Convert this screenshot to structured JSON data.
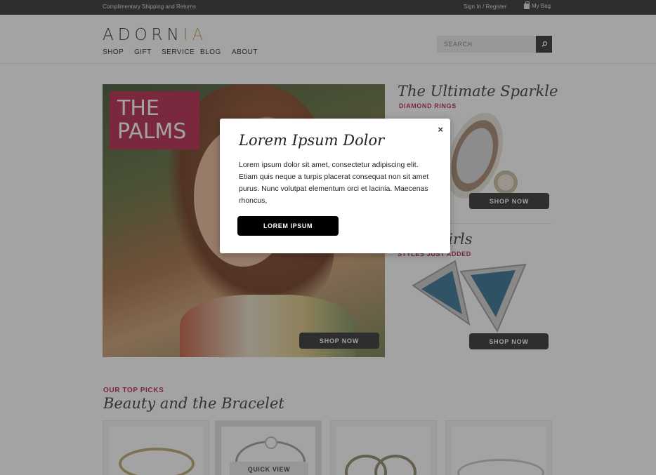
{
  "topbar": {
    "shipping_text": "Complimentary Shipping and Returns",
    "sign_in": "Sign In",
    "register": "Register",
    "bag_label": "My Bag",
    "bag_icon": "shopping-bag-icon"
  },
  "header": {
    "logo_main": "ADORN",
    "logo_accent": "IA",
    "nav": [
      {
        "label": "SHOP"
      },
      {
        "label": "GIFT"
      },
      {
        "label": "SERVICE"
      },
      {
        "label": "BLOG"
      },
      {
        "label": "ABOUT"
      }
    ],
    "search_placeholder": "SEARCH",
    "search_icon": "magnifier-icon"
  },
  "hero": {
    "badge_line1": "THE",
    "badge_line2": "PALMS",
    "button": "SHOP NOW"
  },
  "promos": [
    {
      "title": "The Ultimate Sparkle",
      "subtitle": "DIAMOND RINGS",
      "button": "SHOP NOW"
    },
    {
      "title": "w Girls",
      "subtitle": "STYLES JUST ADDED",
      "button": "SHOP NOW"
    }
  ],
  "top_picks": {
    "kicker": "OUR TOP PICKS",
    "title": "Beauty and the Bracelet",
    "quick_view": "QUICK VIEW"
  },
  "modal": {
    "title": "Lorem Ipsum Dolor",
    "body": "Lorem ipsum dolor sit amet, consectetur adipiscing elit. Etiam quis neque a turpis placerat consequat non sit amet purus. Nunc volutpat elementum orci et lacinia. Maecenas rhoncus,",
    "button": "LOREM IPSUM",
    "close": "×"
  },
  "colors": {
    "accent": "#b41f46",
    "logo_accent": "#c8a24a",
    "dark": "#2b2b2b"
  }
}
